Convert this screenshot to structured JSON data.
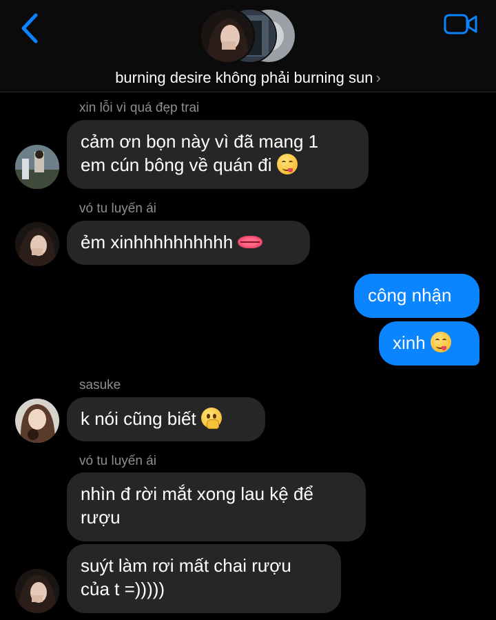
{
  "header": {
    "group_name": "burning desire không phải burning sun",
    "chevron": "›",
    "back_icon": "chevron-left-icon",
    "video_icon": "video-camera-icon",
    "accent_color": "#0a84ff"
  },
  "messages": [
    {
      "sender": "xin lỗi vì quá đẹp trai",
      "text_lines": [
        "cảm ơn bọn này vì đã mang 1",
        "em cún bông về quán đi"
      ],
      "emoji": "yum-face"
    },
    {
      "sender": "vó tu luyến ái",
      "text": "ẻm xinhhhhhhhhhh",
      "emoji": "lips"
    },
    {
      "text": "công nhận",
      "direction": "outgoing"
    },
    {
      "text": "xinh",
      "direction": "outgoing",
      "emoji": "yum-face"
    },
    {
      "sender": "sasuke",
      "text": "k nói cũng biết",
      "emoji": "hand-over-mouth-face"
    },
    {
      "sender": "vó tu luyến ái",
      "text_lines": [
        "nhìn đ rời mắt xong lau kệ để",
        "rượu"
      ]
    },
    {
      "text_lines": [
        "suýt làm rơi mất chai rượu",
        "của t =)))))"
      ]
    }
  ]
}
